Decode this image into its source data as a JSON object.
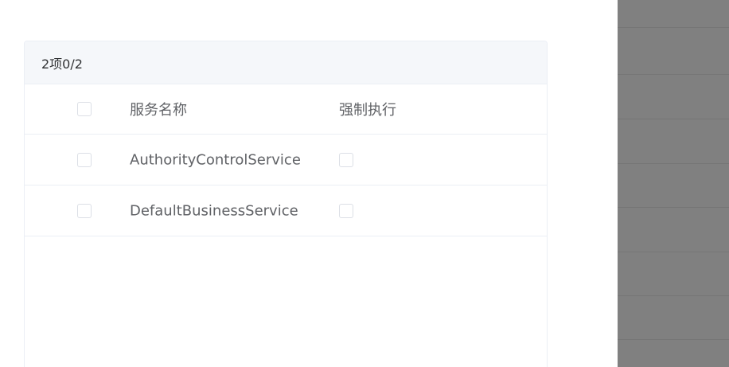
{
  "transfer_panel": {
    "header_text": "2项0/2",
    "columns": {
      "name": "服务名称",
      "force": "强制执行"
    },
    "rows": [
      {
        "name": "AuthorityControlService"
      },
      {
        "name": "DefaultBusinessService"
      }
    ]
  },
  "colors": {
    "header_bg": "#f5f7fa",
    "border": "#ebeef5",
    "text": "#606266",
    "overlay": "#808080"
  }
}
